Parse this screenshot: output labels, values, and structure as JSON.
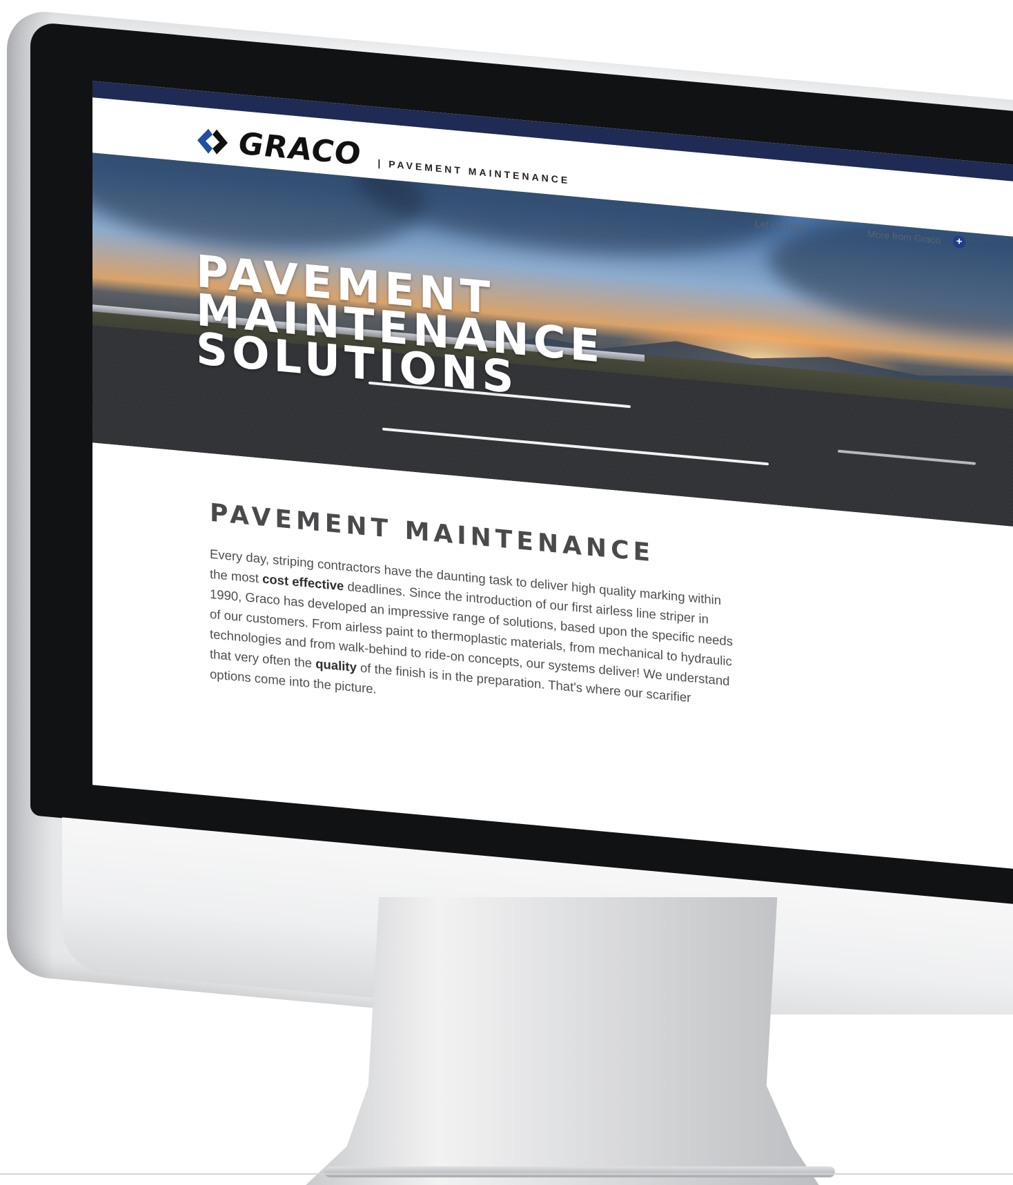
{
  "header": {
    "brand": "GRACO",
    "division": "| PAVEMENT MAINTENANCE",
    "nav": [
      {
        "label": "Let Us Help"
      },
      {
        "label": "More from Graco"
      }
    ]
  },
  "hero": {
    "title_lines": [
      "PAVEMENT",
      "MAINTENANCE",
      "SOLUTIONS"
    ]
  },
  "content": {
    "heading": "PAVEMENT MAINTENANCE",
    "paragraph_parts": [
      "Every day, striping contractors have the daunting task to deliver high quality marking within the most ",
      "cost effective",
      " deadlines. Since the introduction of our first airless line striper in 1990, Graco has developed an impressive range of solutions, based upon the specific needs of our customers. From airless paint to thermoplastic materials, from mechanical to hydraulic technologies and from walk-behind to ride-on concepts, our systems deliver! We understand that very often the ",
      "quality",
      " of the finish is in the preparation. That's where our scarifier options come into the picture."
    ]
  },
  "colors": {
    "brand_navy": "#1f2a55",
    "logo_blue": "#1f4fa0",
    "plus_icon_blue": "#1f3e8a",
    "bezel": "#111213",
    "heading_gray": "#4a4a4c"
  },
  "icons": {
    "logo_mark": "graco-arrows-logo-icon",
    "more_icon": "plus-circle-icon"
  }
}
